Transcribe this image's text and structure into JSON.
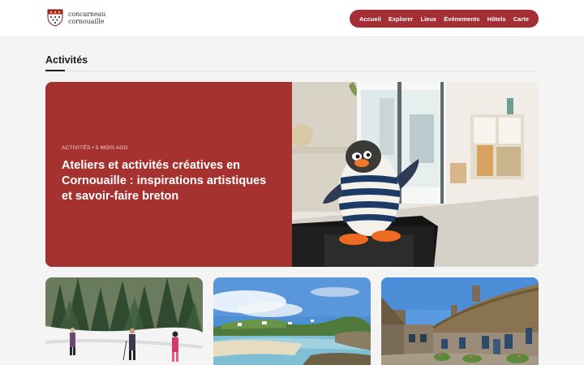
{
  "header": {
    "logo": {
      "line1": "concarneau",
      "line2": "cornouaille"
    },
    "nav": [
      "Accueil",
      "Explorer",
      "Lieux",
      "Événements",
      "Hôtels",
      "Carte"
    ]
  },
  "section": {
    "title": "Activités"
  },
  "featured": {
    "category": "ACTIVITÉS",
    "time": "5 MOIS AGO",
    "title": "Ateliers et activités créatives en Cornouaille : inspirations artistiques et savoir-faire breton",
    "image": "ceramic-penguin-photo"
  },
  "cards": [
    {
      "image": "snowy-forest-hikers-photo"
    },
    {
      "image": "coastal-beach-photo"
    },
    {
      "image": "thatched-cottages-photo"
    }
  ],
  "colors": {
    "accent": "#a32e34",
    "featured_bg": "#a6322f",
    "page_bg": "#f4f4f4"
  }
}
